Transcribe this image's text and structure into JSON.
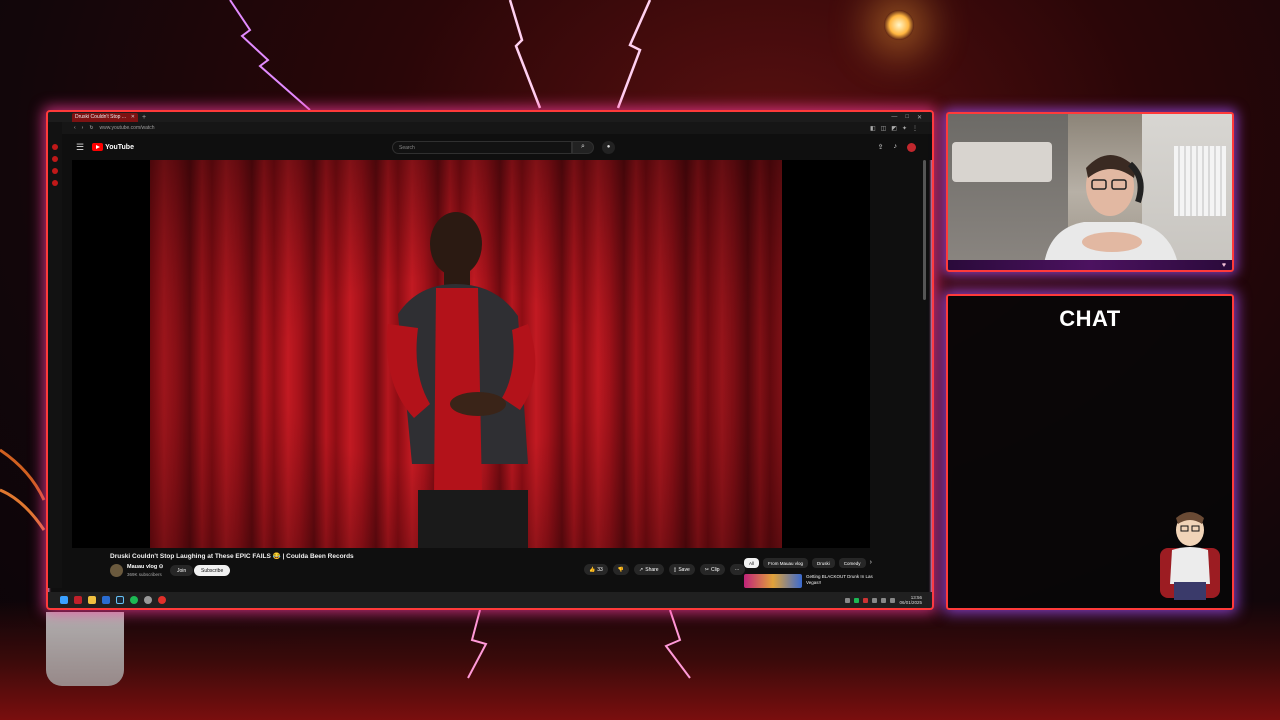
{
  "browser": {
    "tab_title": "Druski Couldn't Stop ...",
    "url": "www.youtube.com/watch"
  },
  "youtube": {
    "logo_text": "YouTube",
    "search_placeholder": "Search",
    "video": {
      "title": "Druski Couldn't Stop Laughing at These EPIC FAILS 😂 | Coulda Been Records",
      "channel_name": "Mauau vlog ⊙",
      "subscribers": "369K subscribers",
      "join_label": "Join",
      "subscribe_label": "Subscribe",
      "like_count": "33",
      "share_label": "Share",
      "save_label": "Save",
      "clip_label": "Clip",
      "more_label": "···"
    },
    "chips": [
      "All",
      "From Mauau vlog",
      "Druski",
      "Comedy"
    ],
    "recommended": {
      "title": "Getting BLACKOUT Drunk In Las Vegas!!"
    }
  },
  "taskbar": {
    "time": "13:56",
    "date": "06/01/2025"
  },
  "overlay": {
    "chat_title": "CHAT"
  },
  "colors": {
    "overlay_border": "#ff3a3a",
    "overlay_glow": "#aa50ff",
    "yt_red": "#ff0000"
  }
}
